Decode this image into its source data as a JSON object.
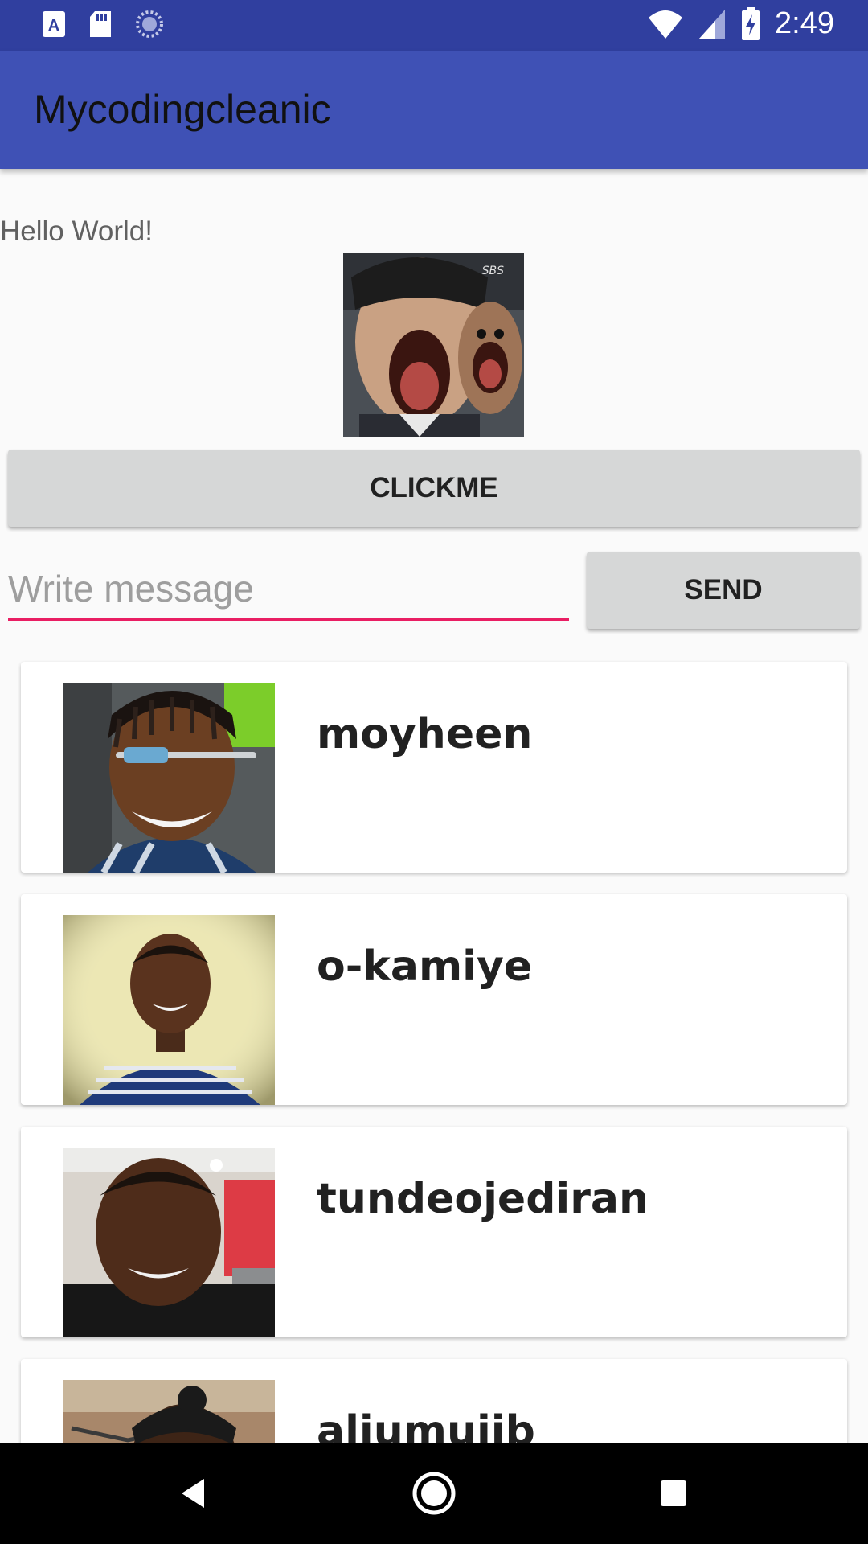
{
  "status_bar": {
    "time": "2:49",
    "left_icons": [
      "a-notification-icon",
      "sd-card-icon",
      "sync-icon"
    ],
    "right_icons": [
      "wifi-icon",
      "signal-icon",
      "battery-charging-icon"
    ]
  },
  "app_bar": {
    "title": "Mycodingcleanic"
  },
  "main": {
    "hello_text": "Hello World!",
    "image_label": "SBS",
    "clickme_label": "CLICKME",
    "message_placeholder": "Write message",
    "message_value": "",
    "send_label": "SEND"
  },
  "users": [
    {
      "name": "moyheen"
    },
    {
      "name": "o-kamiye"
    },
    {
      "name": "tundeojediran"
    },
    {
      "name": "aliumujib"
    }
  ],
  "colors": {
    "status_bar": "#303f9f",
    "app_bar": "#3f51b5",
    "accent": "#e91e63"
  }
}
